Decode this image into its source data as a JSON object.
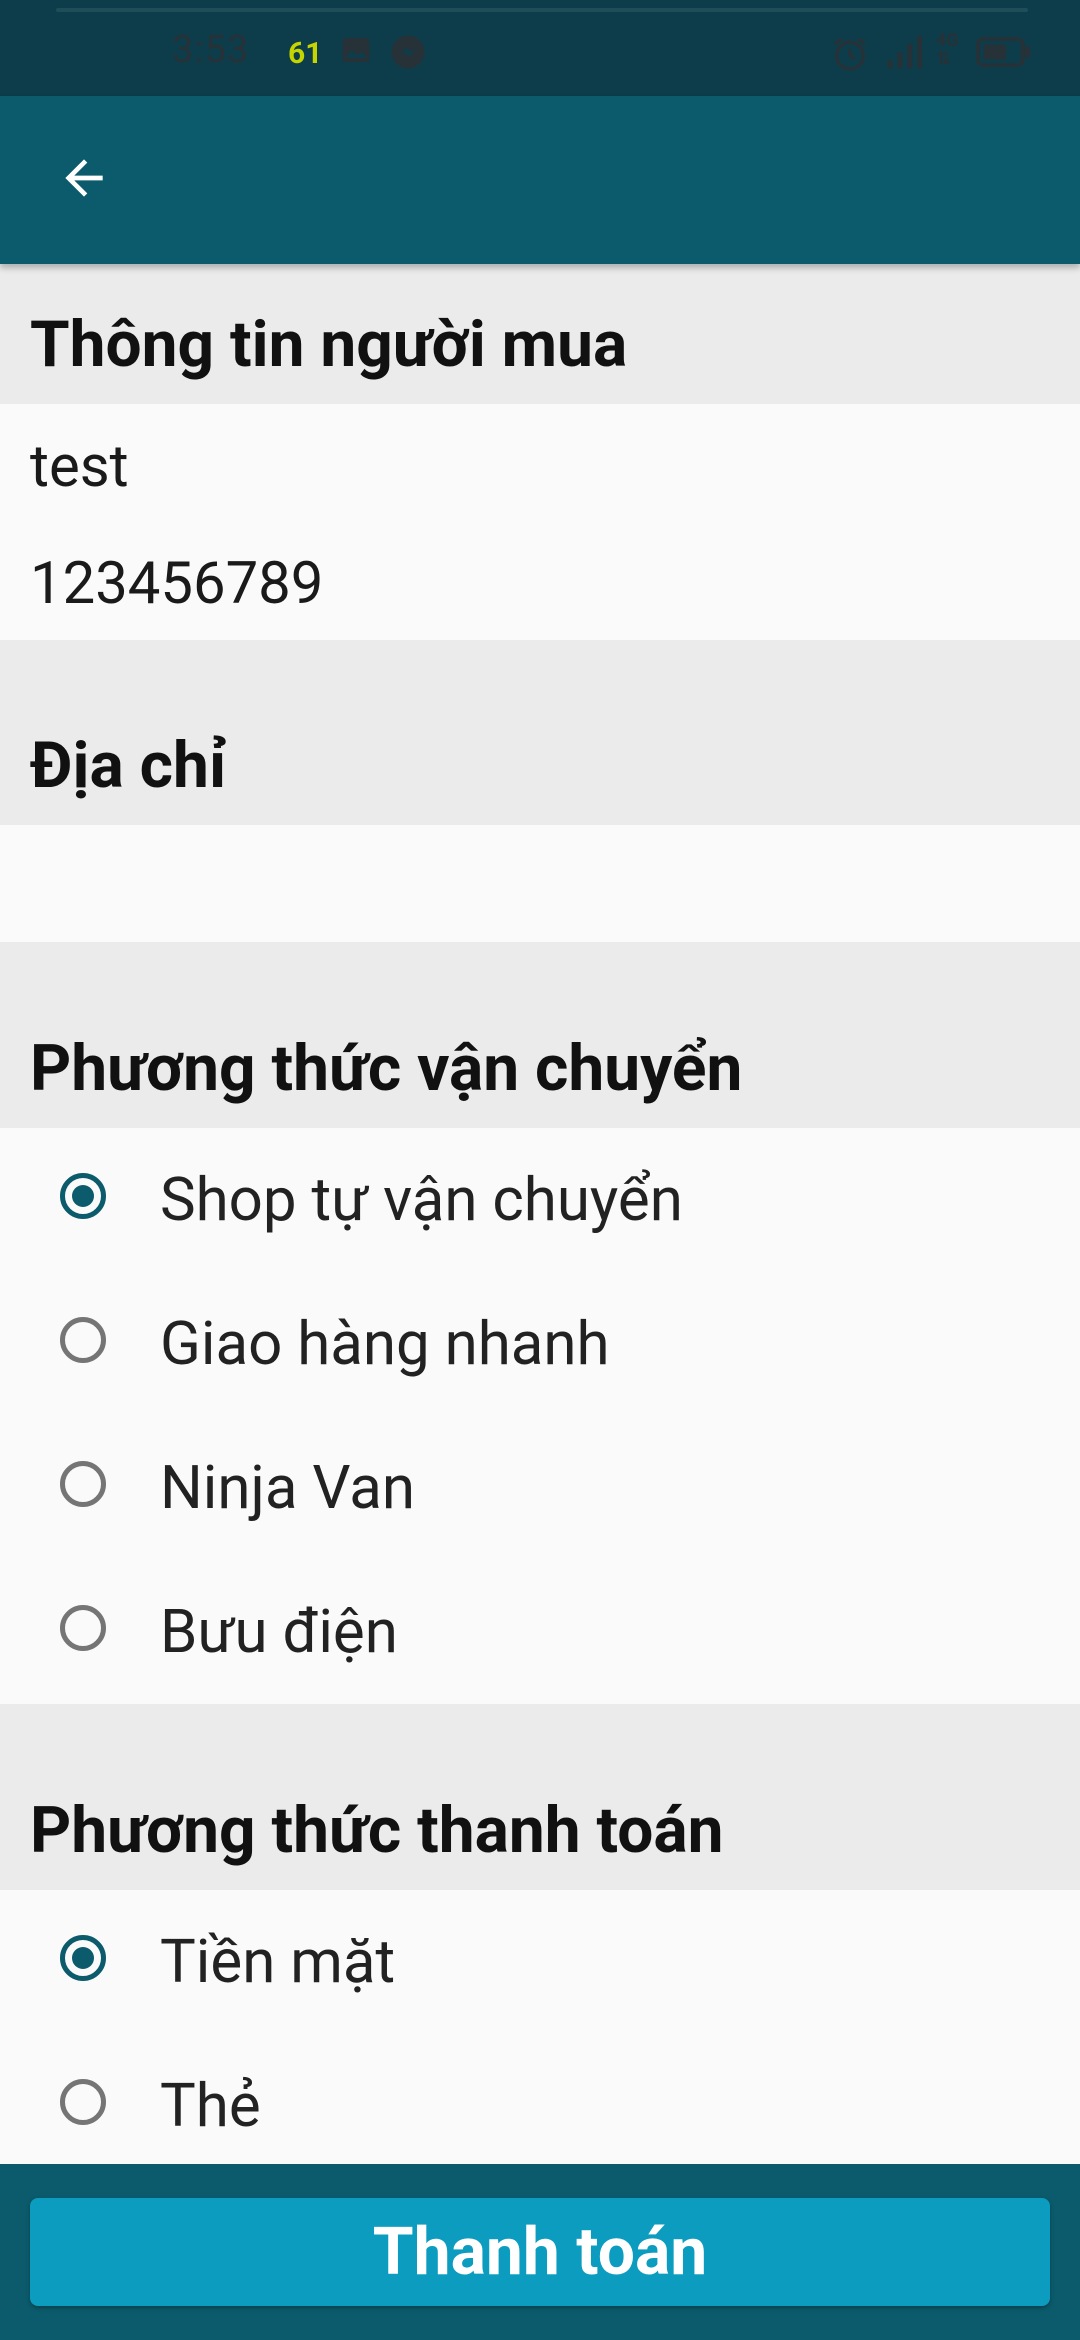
{
  "status_bar": {
    "time": "3:53",
    "network_speed": "61",
    "icons": [
      "image-icon",
      "messenger-icon",
      "alarm-icon",
      "signal-icon",
      "4g-icon",
      "battery-icon"
    ]
  },
  "app_bar": {
    "back_icon": "arrow-back-icon"
  },
  "buyer_info": {
    "title": "Thông tin người mua",
    "name": "test",
    "phone": "123456789"
  },
  "address": {
    "title": "Địa chỉ",
    "value": ""
  },
  "shipping": {
    "title": "Phương thức vận chuyển",
    "options": [
      {
        "label": "Shop tự vận chuyển",
        "checked": true
      },
      {
        "label": "Giao hàng nhanh",
        "checked": false
      },
      {
        "label": "Ninja Van",
        "checked": false
      },
      {
        "label": "Bưu điện",
        "checked": false
      }
    ]
  },
  "payment": {
    "title": "Phương thức thanh toán",
    "options": [
      {
        "label": "Tiền mặt",
        "checked": true
      },
      {
        "label": "Thẻ",
        "checked": false
      }
    ]
  },
  "footer": {
    "pay_button_label": "Thanh toán"
  },
  "colors": {
    "primary": "#0b5b6c",
    "status_bar": "#0d3d4a",
    "button": "#0b9cbf",
    "section_bg": "#ebebeb",
    "content_bg": "#fafafa"
  }
}
